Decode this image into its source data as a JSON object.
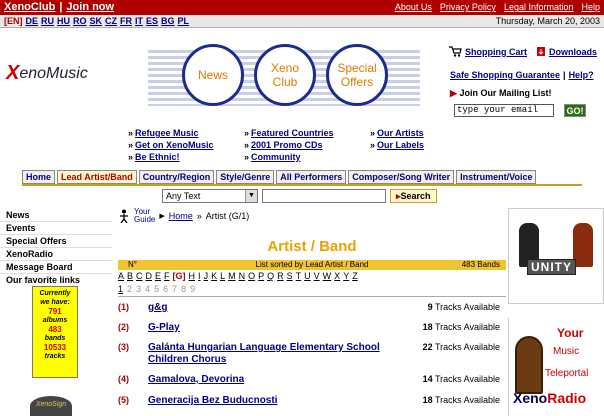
{
  "top_bar": {
    "left_links": [
      "XenoClub",
      "|",
      "Join now"
    ],
    "right_links": [
      "About Us",
      "Privacy Policy",
      "Legal Information",
      "Help"
    ]
  },
  "lang_bar": {
    "current": "[EN]",
    "languages": [
      "DE",
      "RU",
      "HU",
      "RO",
      "SK",
      "CZ",
      "FR",
      "IT",
      "ES",
      "BG",
      "PL"
    ],
    "date": "Thursday, March 20, 2003"
  },
  "logo": {
    "mark": "X",
    "text": "enoMusic"
  },
  "banner": {
    "circles": [
      "News",
      "Xeno Club",
      "Special Offers"
    ]
  },
  "right_box": {
    "cart": "Shopping Cart",
    "downloads": "Downloads",
    "guarantee": "Safe Shopping Guarantee",
    "sep": "|",
    "help": "Help?",
    "mailing": "Join Our Mailing List!",
    "email_placeholder": "type your email",
    "go": "GO!"
  },
  "quick_links": {
    "col1": [
      "Refugee Music",
      "Get on XenoMusic",
      "Be Ethnic!"
    ],
    "col2": [
      "Featured Countries",
      "2001 Promo CDs",
      "Community"
    ],
    "col3": [
      "Our Artists",
      "Our Labels"
    ]
  },
  "tabs": [
    "Home",
    "Lead Artist/Band",
    "Country/Region",
    "Style/Genre",
    "All Performers",
    "Composer/Song Writer",
    "Instrument/Voice"
  ],
  "search": {
    "select_value": "Any Text",
    "button": "Search"
  },
  "left_nav": [
    "News",
    "Events",
    "Special Offers",
    "XenoRadio",
    "Message Board",
    "Our favorite links"
  ],
  "counter": {
    "line1": "Currently",
    "line2": "we have:",
    "albums_num": "791",
    "albums_label": "albums",
    "bands_num": "483",
    "bands_label": "bands",
    "tracks_num": "10533",
    "tracks_label": "tracks"
  },
  "breadcrumb": {
    "guide1": "Your",
    "guide2": "Guide",
    "arrow": "▶",
    "home": "Home",
    "sep": "»",
    "current": "Artist (G/1)"
  },
  "page_title": "Artist / Band",
  "list_bar": {
    "n": "N°",
    "middle": "List sorted by Lead Artist / Band",
    "count": "483 Bands"
  },
  "alphabet": [
    "A",
    "B",
    "C",
    "D",
    "E",
    "F",
    "[G]",
    "H",
    "I",
    "J",
    "K",
    "L",
    "M",
    "N",
    "O",
    "P",
    "Q",
    "R",
    "S",
    "T",
    "U",
    "V",
    "W",
    "X",
    "Y",
    "Z"
  ],
  "pages": [
    "1",
    "2",
    "3",
    "4",
    "5",
    "6",
    "7",
    "8",
    "9"
  ],
  "rows": [
    {
      "num": "(1)",
      "name": "g&g",
      "count": "9",
      "label": "Tracks Available"
    },
    {
      "num": "(2)",
      "name": "G-Play",
      "count": "18",
      "label": "Tracks Available"
    },
    {
      "num": "(3)",
      "name": "Galánta Hungarian Language Elementary School Children Chorus",
      "count": "22",
      "label": "Tracks Available"
    },
    {
      "num": "(4)",
      "name": "Gamalova, Devorina",
      "count": "14",
      "label": "Tracks Available"
    },
    {
      "num": "(5)",
      "name": "Generacija Bez Buducnosti",
      "count": "18",
      "label": "Tracks Available"
    }
  ],
  "ads": {
    "unity": "UNITY",
    "radio_lines": [
      "Your",
      "Music",
      "Teleportal"
    ],
    "radio_brand1": "Xeno",
    "radio_brand2": "Radio"
  },
  "bottom_logo": "XenoSign"
}
